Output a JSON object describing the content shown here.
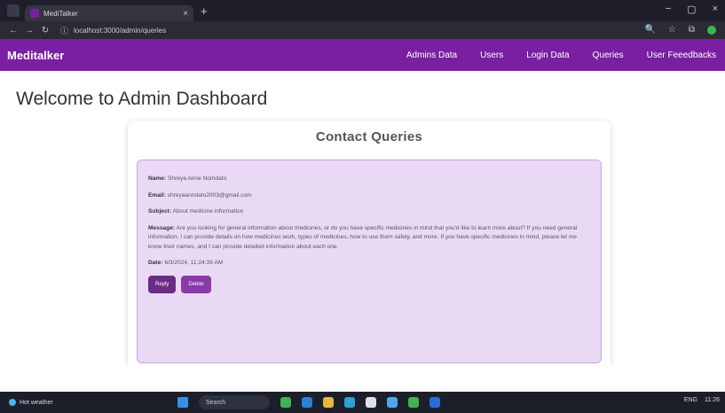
{
  "browser": {
    "tab_title": "MediTalker",
    "tab_close": "×",
    "new_tab": "+",
    "win_minimize": "−",
    "win_restore": "▢",
    "win_close": "×",
    "back": "←",
    "forward": "→",
    "reload": "↻",
    "url": "localhost:3000/admin/queries",
    "info_icon": "ⓘ",
    "zoom_icon": "🔍",
    "star_icon": "☆",
    "ext_icon": "⧉"
  },
  "navbar": {
    "brand": "Meditalker",
    "links": [
      "Admins Data",
      "Users",
      "Login Data",
      "Queries",
      "User Feeedbacks"
    ]
  },
  "main": {
    "heading": "Welcome to Admin Dashboard",
    "card_title": "Contact Queries",
    "query": {
      "name_label": "Name:",
      "name": "Shreya Anne Nomdato",
      "email_label": "Email:",
      "email": "shreyaanndato2003@gmail.com",
      "subject_label": "Subject:",
      "subject": "About medicine information",
      "message_label": "Message:",
      "message": "Are you looking for general information about medicines, or do you have specific medicines in mind that you'd like to learn more about? If you need general information, I can provide details on how medicines work, types of medicines, how to use them safely, and more. If you have specific medicines in mind, please let me know their names, and I can provide detailed information about each one.",
      "date_label": "Date:",
      "date": "6/3/2024, 11:24:39 AM",
      "reply_label": "Reply",
      "delete_label": "Delete"
    }
  },
  "taskbar": {
    "weather": "Hot weather",
    "search": "Search",
    "tray_lang": "ENG",
    "tray_time": "11:26"
  },
  "colors": {
    "navbar": "#7a1fa2",
    "query_bg": "#ead9f5",
    "button": "#6a2d86"
  }
}
